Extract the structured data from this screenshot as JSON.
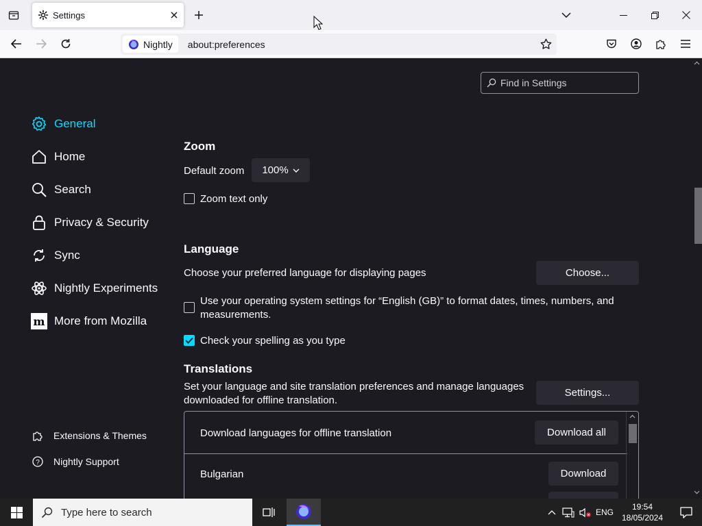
{
  "tab": {
    "title": "Settings"
  },
  "navbar": {
    "identity_label": "Nightly",
    "url": "about:preferences"
  },
  "search": {
    "placeholder": "Find in Settings"
  },
  "sidebar": {
    "items": [
      {
        "label": "General",
        "icon": "gear-icon",
        "selected": true
      },
      {
        "label": "Home",
        "icon": "home-icon"
      },
      {
        "label": "Search",
        "icon": "search-icon"
      },
      {
        "label": "Privacy & Security",
        "icon": "lock-icon"
      },
      {
        "label": "Sync",
        "icon": "sync-icon"
      },
      {
        "label": "Nightly Experiments",
        "icon": "experiments-icon"
      },
      {
        "label": "More from Mozilla",
        "icon": "mozilla-icon"
      }
    ],
    "footer": [
      {
        "label": "Extensions & Themes",
        "icon": "puzzle-icon"
      },
      {
        "label": "Nightly Support",
        "icon": "help-icon"
      }
    ]
  },
  "zoom": {
    "heading": "Zoom",
    "default_label": "Default zoom",
    "default_value": "100%",
    "text_only_label": "Zoom text only",
    "text_only_checked": false
  },
  "language": {
    "heading": "Language",
    "description": "Choose your preferred language for displaying pages",
    "choose_button": "Choose...",
    "os_settings_line1": "Use your operating system settings for “English (GB)” to format dates, times, numbers, and",
    "os_settings_line2": "measurements.",
    "os_settings_checked": false,
    "spell_check_label": "Check your spelling as you type",
    "spell_check_checked": true
  },
  "translations": {
    "heading": "Translations",
    "description_line1": "Set your language and site translation preferences and manage languages",
    "description_line2": "downloaded for offline translation.",
    "settings_button": "Settings...",
    "download_all_label": "Download languages for offline translation",
    "download_all_button": "Download all",
    "languages": [
      {
        "name": "Bulgarian",
        "button": "Download"
      }
    ]
  },
  "taskbar": {
    "search_placeholder": "Type here to search",
    "language": "ENG",
    "time": "19:54",
    "date": "18/05/2024"
  },
  "colors": {
    "accent": "#00ddff",
    "page_bg": "#1c1b22",
    "button_bg": "#2b2a33"
  }
}
